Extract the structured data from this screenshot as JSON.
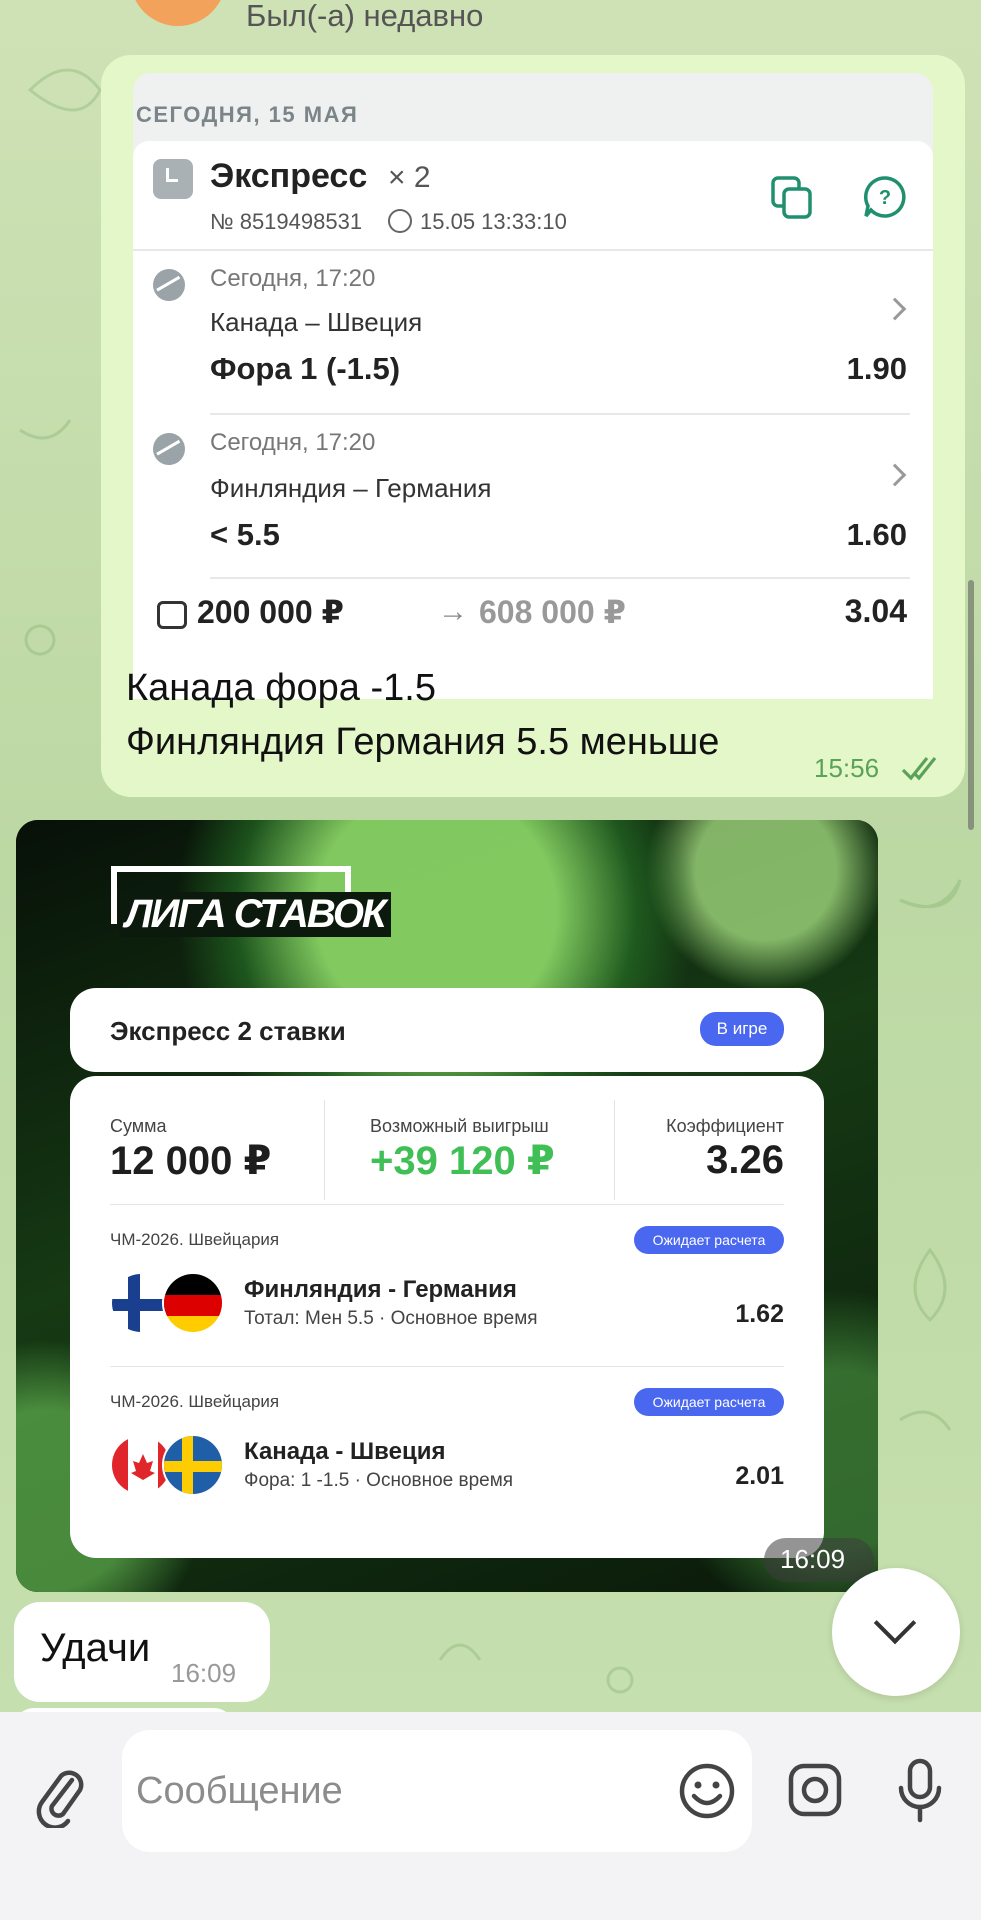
{
  "header": {
    "status": "Был(-а) недавно"
  },
  "outgoing": {
    "screenshot": {
      "date_header": "СЕГОДНЯ, 15 МАЯ",
      "title": "Экспресс",
      "multiplier": "× 2",
      "bet_number": "№ 8519498531",
      "bet_time": "15.05 13:33:10",
      "legs": [
        {
          "time": "Сегодня, 17:20",
          "match": "Канада – Швеция",
          "pick": "Фора 1 (-1.5)",
          "odd": "1.90"
        },
        {
          "time": "Сегодня, 17:20",
          "match": "Финляндия – Германия",
          "pick": "< 5.5",
          "odd": "1.60"
        }
      ],
      "stake": "200 000 ₽",
      "arrow": "→",
      "potential": "608 000 ₽",
      "total_odd": "3.04"
    },
    "caption_line1": "Канада фора -1.5",
    "caption_line2": "Финляндия Германия 5.5 меньше",
    "time": "15:56",
    "read": true
  },
  "incoming_image": {
    "logo": "ЛИГА СТАВОК",
    "title": "Экспресс 2 ставки",
    "status_badge": "В игре",
    "sum_label": "Сумма",
    "sum_value": "12 000 ₽",
    "win_label": "Возможный выигрыш",
    "win_value": "+39 120 ₽",
    "coef_label": "Коэффициент",
    "coef_value": "3.26",
    "events": [
      {
        "league": "ЧМ-2026. Швейцария",
        "badge": "Ожидает расчета",
        "title": "Финляндия - Германия",
        "subtitle": "Тотал: Мен 5.5 · Основное время",
        "odd": "1.62"
      },
      {
        "league": "ЧМ-2026. Швейцария",
        "badge": "Ожидает расчета",
        "title": "Канада - Швеция",
        "subtitle": "Фора: 1 -1.5 · Основное время",
        "odd": "2.01"
      }
    ],
    "time": "16:09"
  },
  "incoming_text": {
    "text": "Удачи",
    "time": "16:09"
  },
  "composer": {
    "placeholder": "Сообщение"
  },
  "colors": {
    "accent_green": "#5aa25a",
    "win_green": "#3fbf55",
    "badge_blue": "#4a67f0",
    "bubble_out": "#e4f7c9"
  },
  "icons": [
    "copy-icon",
    "help-icon",
    "clock-icon",
    "hockey-puck-icon",
    "chevron-right-icon",
    "wallet-icon",
    "double-check-icon",
    "chevron-down-icon",
    "paperclip-icon",
    "emoji-icon",
    "instagram-camera-icon",
    "microphone-icon"
  ]
}
